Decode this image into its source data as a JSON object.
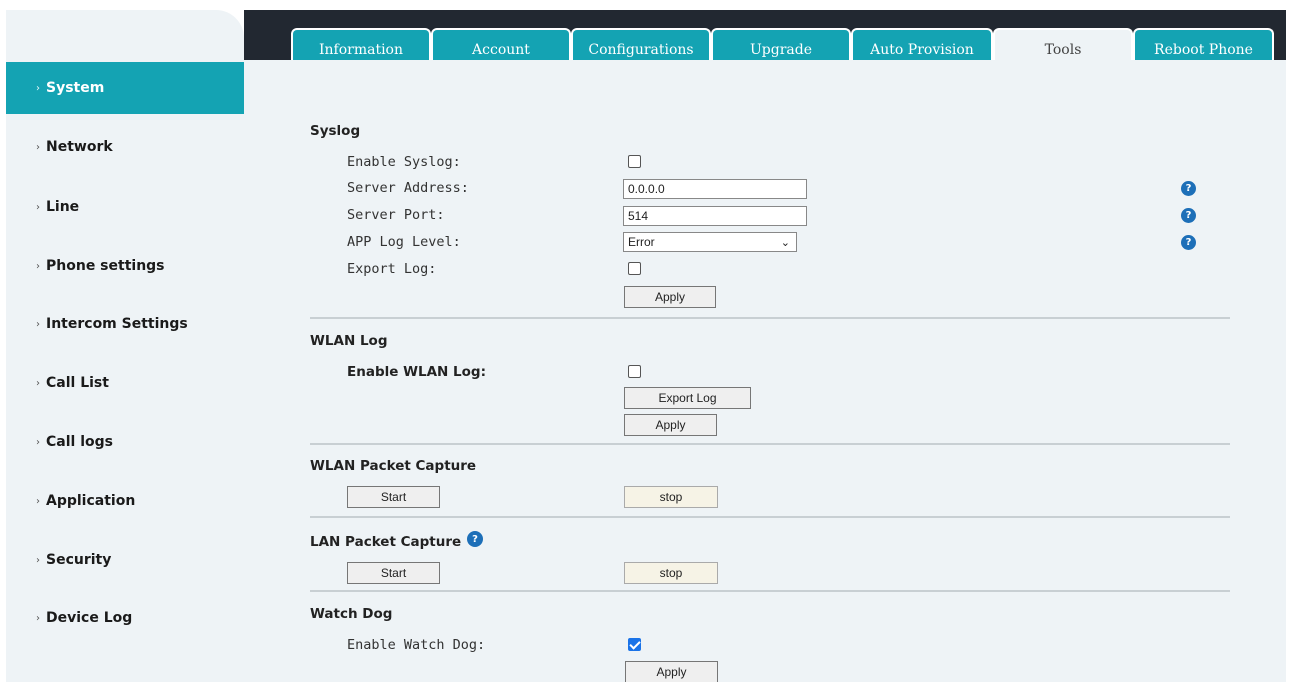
{
  "sidebar": {
    "items": [
      {
        "label": "System"
      },
      {
        "label": "Network"
      },
      {
        "label": "Line"
      },
      {
        "label": "Phone settings"
      },
      {
        "label": "Intercom Settings"
      },
      {
        "label": "Call List"
      },
      {
        "label": "Call logs"
      },
      {
        "label": "Application"
      },
      {
        "label": "Security"
      },
      {
        "label": "Device Log"
      }
    ],
    "chevron": "›"
  },
  "tabs": [
    {
      "label": "Information"
    },
    {
      "label": "Account"
    },
    {
      "label": "Configurations"
    },
    {
      "label": "Upgrade"
    },
    {
      "label": "Auto Provision"
    },
    {
      "label": "Tools"
    },
    {
      "label": "Reboot Phone"
    }
  ],
  "syslog": {
    "title": "Syslog",
    "enable_label": "Enable Syslog:",
    "server_address_label": "Server Address:",
    "server_address_value": "0.0.0.0",
    "server_port_label": "Server Port:",
    "server_port_value": "514",
    "app_log_level_label": "APP Log Level:",
    "app_log_level_value": "Error",
    "export_log_label": "Export Log:",
    "apply_label": "Apply"
  },
  "wlan_log": {
    "title": "WLAN Log",
    "enable_label": "Enable WLAN Log:",
    "export_button": "Export Log",
    "apply_label": "Apply"
  },
  "wlan_capture": {
    "title": "WLAN Packet Capture",
    "start_label": "Start",
    "stop_label": "stop"
  },
  "lan_capture": {
    "title": "LAN Packet Capture",
    "start_label": "Start",
    "stop_label": "stop"
  },
  "watchdog": {
    "title": "Watch Dog",
    "enable_label": "Enable Watch Dog:",
    "enabled": true,
    "apply_label": "Apply"
  },
  "icons": {
    "help": "?",
    "dropdown": "⌄"
  },
  "colors": {
    "accent": "#14a3b3",
    "topbar": "#222831",
    "panel": "#eef3f6",
    "help_icon": "#1d6fb8",
    "checkbox_checked": "#1a73e8"
  }
}
